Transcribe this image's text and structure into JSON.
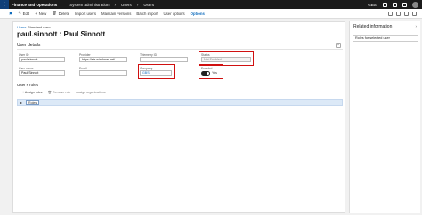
{
  "topbar": {
    "app_title": "Finance and Operations",
    "breadcrumb": [
      "System administration",
      "Users",
      "Users"
    ],
    "company": "GBSI"
  },
  "actions": {
    "save": "",
    "edit": "Edit",
    "new": "New",
    "delete": "Delete",
    "import_users": "Import users",
    "maintain_versions": "Maintain versions",
    "batch_import": "Batch import",
    "user_options": "User options",
    "options": "Options"
  },
  "page": {
    "users_link": "Users",
    "view": "Standard view",
    "title": "paul.sinnott : Paul Sinnott"
  },
  "user_details": {
    "section_title": "User details",
    "user_id_label": "User ID",
    "user_id_value": "paul.sinnott",
    "provider_label": "Provider",
    "provider_value": "https://sts.windows.net/",
    "telemetry_label": "Telemetry ID",
    "status_label": "Status",
    "status_value": "Not Enabled",
    "user_name_label": "User name",
    "user_name_value": "Paul Sinnott",
    "email_label": "Email",
    "company_label": "Company",
    "company_value": "GBSI",
    "enabled_label": "Enabled",
    "enabled_value": "Yes"
  },
  "roles": {
    "title": "User's roles",
    "assign_roles": "Assign roles",
    "remove_role": "Remove role",
    "assign_orgs": "Assign organizations",
    "row_label": "Roles"
  },
  "sidebar": {
    "title": "Related information",
    "box_label": "Roles for selected user"
  }
}
